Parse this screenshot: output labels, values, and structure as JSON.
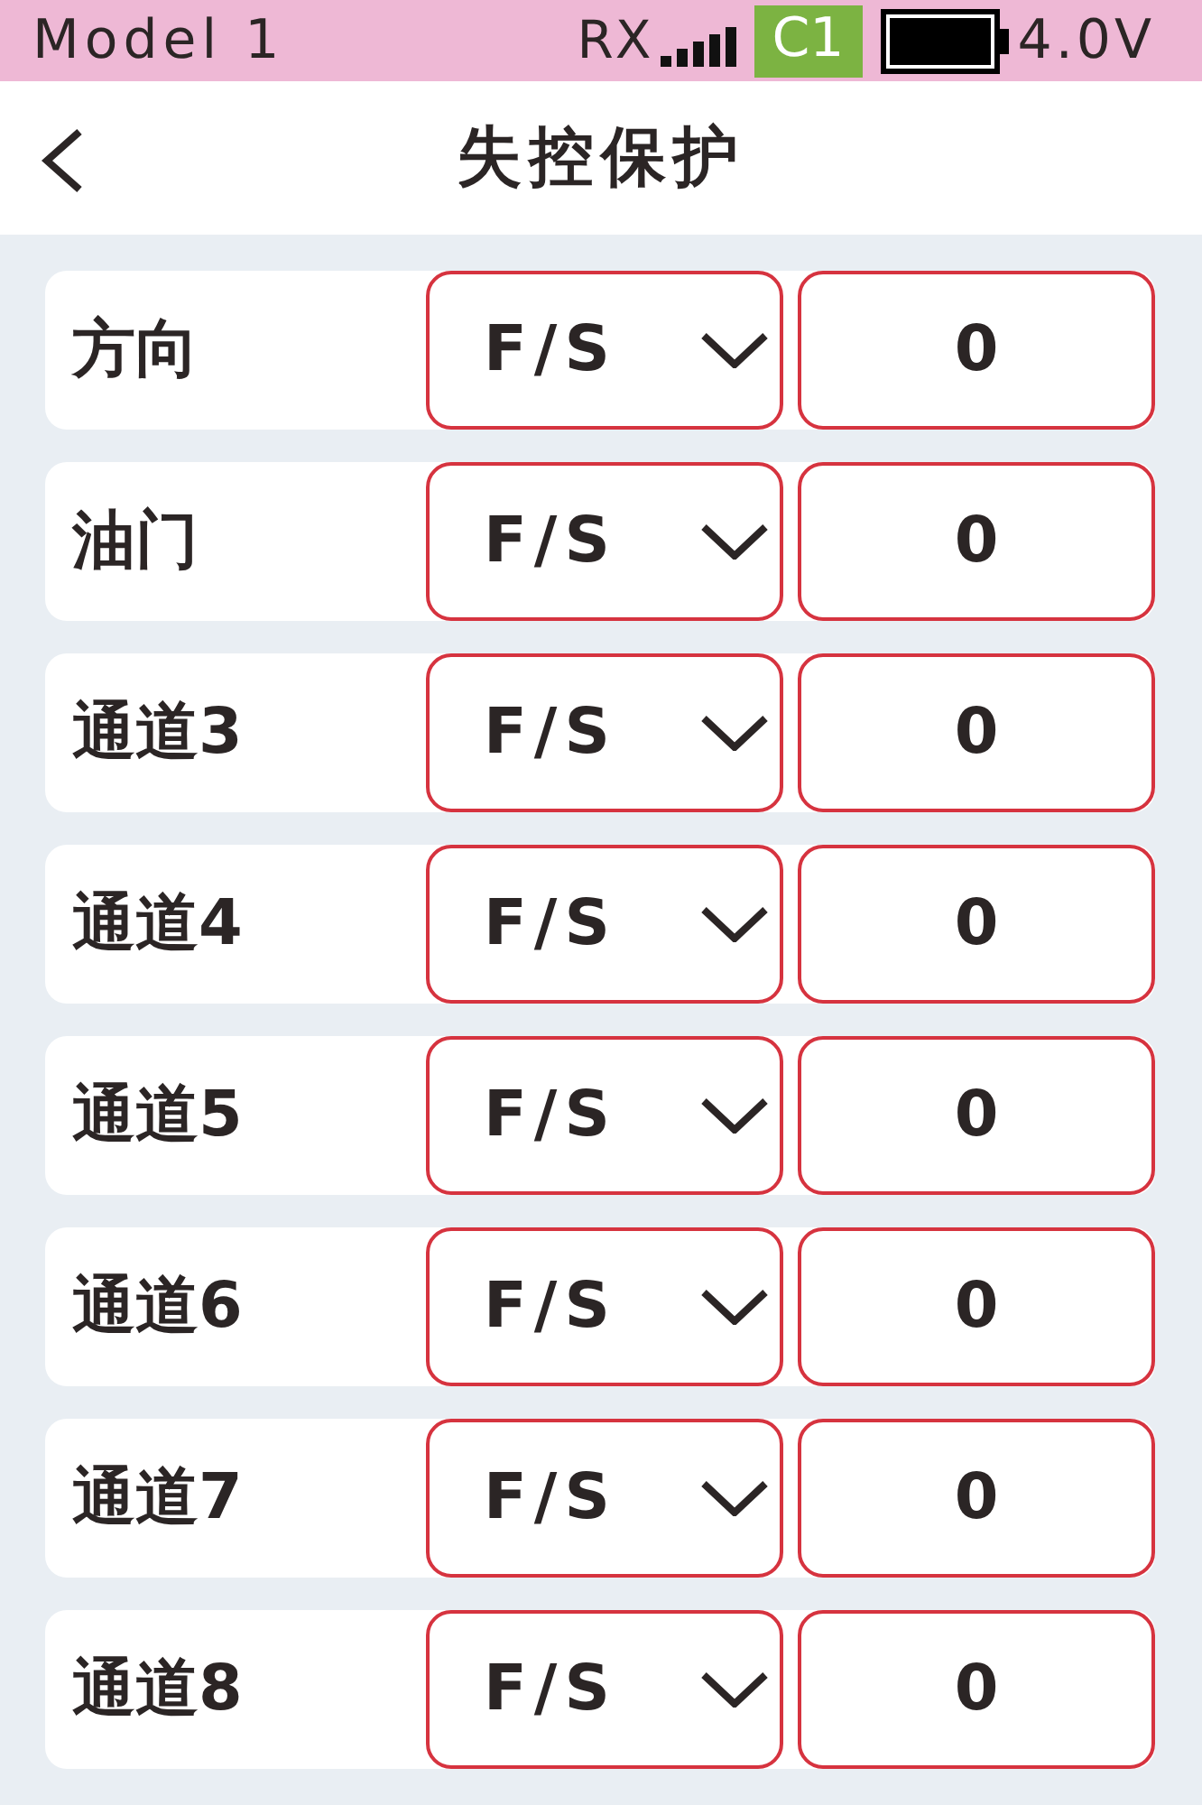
{
  "status_bar": {
    "model": "Model 1",
    "rx_label": "RX",
    "channel_badge": "C1",
    "voltage": "4.0V"
  },
  "header": {
    "title": "失控保护"
  },
  "channels": [
    {
      "name": "方向",
      "mode": "F/S",
      "value": "0"
    },
    {
      "name": "油门",
      "mode": "F/S",
      "value": "0"
    },
    {
      "name": "通道3",
      "mode": "F/S",
      "value": "0"
    },
    {
      "name": "通道4",
      "mode": "F/S",
      "value": "0"
    },
    {
      "name": "通道5",
      "mode": "F/S",
      "value": "0"
    },
    {
      "name": "通道6",
      "mode": "F/S",
      "value": "0"
    },
    {
      "name": "通道7",
      "mode": "F/S",
      "value": "0"
    },
    {
      "name": "通道8",
      "mode": "F/S",
      "value": "0"
    }
  ]
}
